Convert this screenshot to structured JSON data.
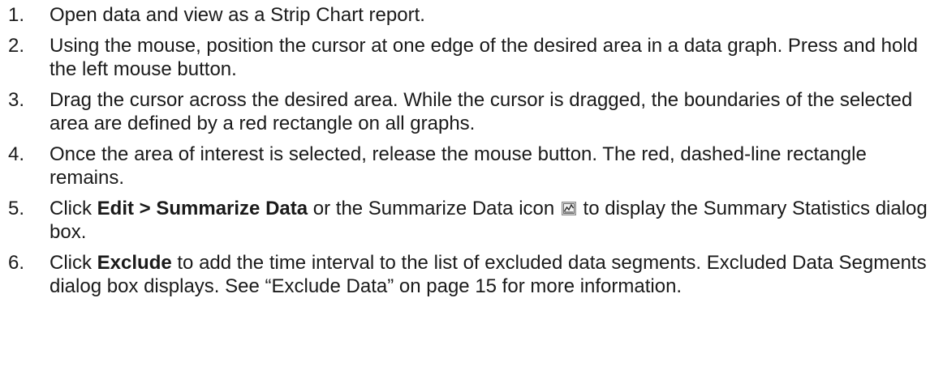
{
  "steps": [
    {
      "num": "1.",
      "text": "Open data and view as a Strip Chart report."
    },
    {
      "num": "2.",
      "text": "Using the mouse, position the cursor at one edge of the desired area in a data graph. Press and hold the left mouse button."
    },
    {
      "num": "3.",
      "text": "Drag the cursor across the desired area. While the cursor is dragged, the boundaries of the selected area are defined by a red rectangle on all graphs."
    },
    {
      "num": "4.",
      "text": "Once the area of interest is selected, release the mouse button. The red, dashed-line rectangle remains."
    },
    {
      "num": "5.",
      "prefix": "Click ",
      "bold": "Edit > Summarize Data",
      "middle": " or the Summarize Data icon ",
      "icon": "summarize-data-icon",
      "suffix": " to display the Summary Statistics dialog box."
    },
    {
      "num": "6.",
      "prefix": "Click ",
      "bold": "Exclude",
      "suffix": " to add the time interval to the list of excluded data segments. Excluded Data Segments dialog box displays. See “Exclude Data” on page 15 for more information."
    }
  ]
}
